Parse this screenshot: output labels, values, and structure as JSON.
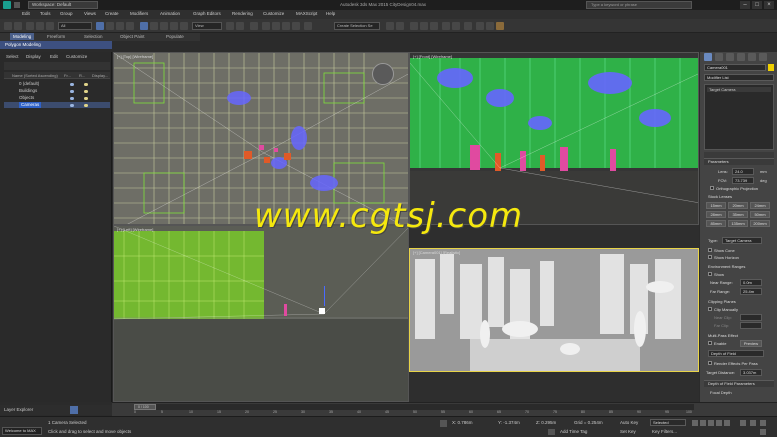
{
  "title_bar": {
    "workspace": "Workspace: Default",
    "title": "Autodesk 3ds Max 2015    CityDesign04.max",
    "search_placeholder": "Type a keyword or phrase"
  },
  "menu": [
    "Edit",
    "Tools",
    "Group",
    "Views",
    "Create",
    "Modifiers",
    "Animation",
    "Graph Editors",
    "Rendering",
    "Customize",
    "MAXScript",
    "Help"
  ],
  "toolbar": {
    "filter": "All",
    "view": "View",
    "selection_set": "Create Selection Se"
  },
  "ribbon": {
    "tabs": [
      "Modeling",
      "Freeform",
      "Selection",
      "Object Paint",
      "Populate"
    ],
    "sub": "Polygon Modeling"
  },
  "scene_explorer": {
    "tabs": [
      "Select",
      "Display",
      "Edit",
      "Customize"
    ],
    "columns": [
      "Name (Sorted Ascending)",
      "Fr...",
      "R...",
      "Display..."
    ],
    "rows": [
      {
        "name": "0 (default)",
        "selected": false
      },
      {
        "name": "Buildings",
        "selected": false
      },
      {
        "name": "Objects",
        "selected": false
      },
      {
        "name": "Cameras",
        "selected": true
      }
    ],
    "layer_explorer": "Layer Explorer"
  },
  "viewports": {
    "top": "[+] [Top] [Wireframe]",
    "front": "[+] [Front] [Wireframe]",
    "left": "[+] [Left] [Wireframe]",
    "camera": "[+] [Camera001] [Realistic]"
  },
  "command_panel": {
    "object_name": "Camera001",
    "modifier_list": "Modifier List",
    "stack_item": "Target Camera",
    "parameters": "Parameters",
    "lens_label": "Lens:",
    "lens_value": "24.0",
    "lens_unit": "mm",
    "fov_label": "FOV:",
    "fov_value": "73.739",
    "fov_unit": "deg",
    "ortho": "Orthographic Projection",
    "stock_lenses": "Stock Lenses",
    "lenses": [
      "15mm",
      "20mm",
      "24mm",
      "28mm",
      "35mm",
      "50mm",
      "85mm",
      "135mm",
      "200mm"
    ],
    "type_label": "Type:",
    "type_value": "Target Camera",
    "show_cone": "Show Cone",
    "show_horizon": "Show Horizon",
    "env_ranges": "Environment Ranges",
    "show": "Show",
    "near_range": "Near Range:",
    "near_value": "0.0m",
    "far_range": "Far Range:",
    "far_value": "25.4m",
    "clipping": "Clipping Planes",
    "clip_manually": "Clip Manually",
    "near_clip": "Near Clip:",
    "far_clip": "Far Clip:",
    "multi_pass": "Multi-Pass Effect",
    "enable": "Enable",
    "preview": "Preview",
    "effect": "Depth of Field",
    "render_effects": "Render Effects Per Pass",
    "target_distance": "Target Distance:",
    "target_value": "3.037m",
    "dof_params": "Depth of Field Parameters",
    "focal_depth": "Focal Depth"
  },
  "timeline": {
    "frame": "0 / 100",
    "ticks": [
      "0",
      "5",
      "10",
      "15",
      "20",
      "25",
      "30",
      "35",
      "40",
      "45",
      "50",
      "55",
      "60",
      "65",
      "70",
      "75",
      "80",
      "85",
      "90",
      "95",
      "100"
    ]
  },
  "status": {
    "welcome": "Welcome to MAX",
    "selected": "1 Camera Selected",
    "prompt": "Click and drag to select and move objects",
    "x": "X: 0.786m",
    "y": "Y: -1.374m",
    "z": "Z: 0.295m",
    "grid": "Grid = 0.254m",
    "add_time_tag": "Add Time Tag",
    "auto_key": "Auto Key",
    "key_mode": "Selected",
    "set_key": "Set Key",
    "key_filters": "Key Filters..."
  },
  "watermark": "www.cgtsj.com",
  "colors": {
    "active_border": "#e8d448",
    "accent_blue": "#3d5080",
    "selection": "#2f62c8",
    "watermark": "#f5e80e"
  }
}
